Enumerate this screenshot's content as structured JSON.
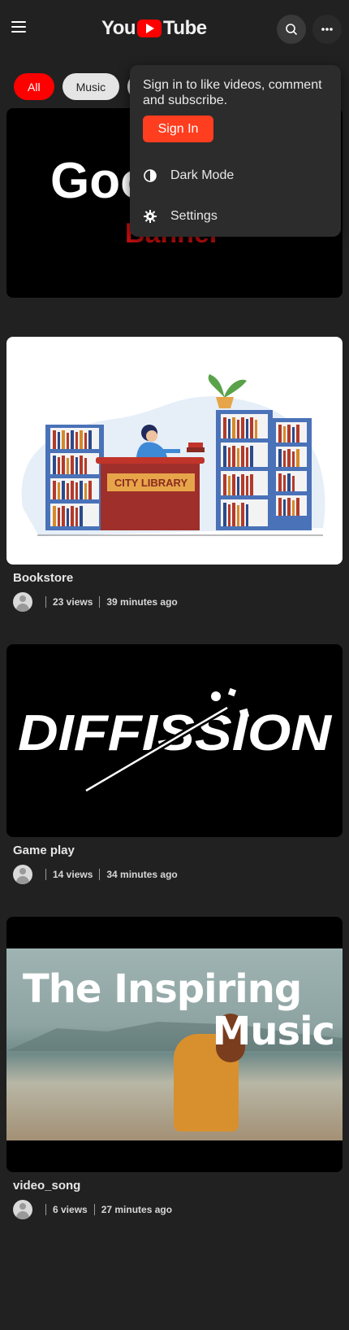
{
  "header": {
    "logo_left": "You",
    "logo_right": "Tube"
  },
  "chips": [
    {
      "label": "All"
    },
    {
      "label": "Music"
    }
  ],
  "menu": {
    "message": "Sign in to like videos, comment and subscribe.",
    "signin_label": "Sign In",
    "items": [
      {
        "label": "Dark Mode",
        "icon": "contrast-icon"
      },
      {
        "label": "Settings",
        "icon": "gear-icon"
      }
    ]
  },
  "videos": [
    {
      "thumb_text_1": "Goo",
      "thumb_text_2": "Banner"
    },
    {
      "title": "Bookstore",
      "views": "23 views",
      "time": "39 minutes ago",
      "thumb_sign": "CITY LIBRARY"
    },
    {
      "title": "Game play",
      "views": "14 views",
      "time": "34 minutes ago",
      "thumb_text": "DIFFISSION"
    },
    {
      "title": "video_song",
      "views": "6 views",
      "time": "27 minutes ago",
      "thumb_line_1": "The Inspiring",
      "thumb_line_2": "Music"
    }
  ],
  "colors": {
    "background": "#212121",
    "accent": "#ff0000",
    "signin": "#ff3d1f"
  }
}
